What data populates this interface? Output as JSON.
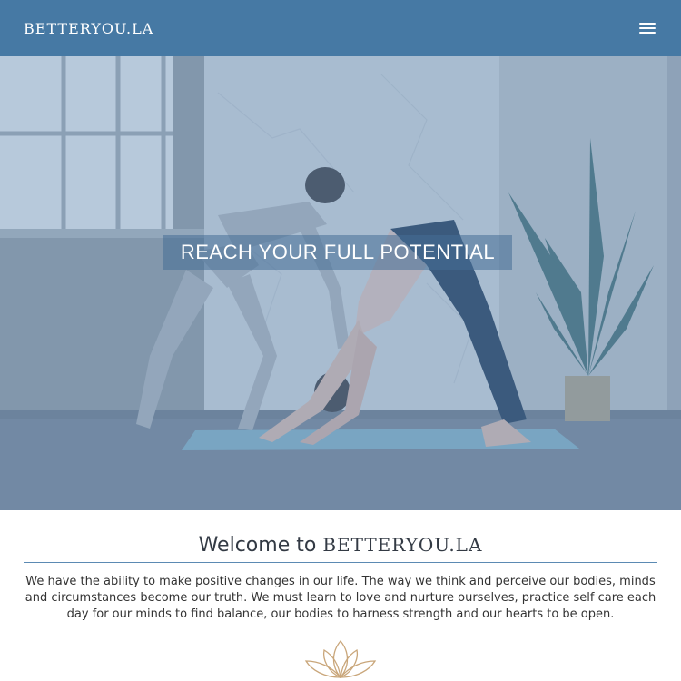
{
  "navbar": {
    "brand": "BETTERYOU.LA",
    "menu_icon": "hamburger-menu-icon"
  },
  "hero": {
    "title": "REACH YOUR FULL POTENTIAL",
    "image": "two women doing yoga, one in downward dog on a mat, instructor adjusting"
  },
  "welcome": {
    "heading_prefix": "Welcome to",
    "heading_brand": "BETTERYOU.LA",
    "body": "We have the ability to make positive changes in our life. The way we think and perceive our bodies, minds and circumstances become our truth. We must learn to love and nurture ourselves, practice self care each day for our minds to find balance, our bodies to harness strength and our hearts to be open.",
    "ornament": "lotus-icon"
  },
  "colors": {
    "navbar": "#4679a4",
    "hero_overlay": "#6f93b8",
    "rule": "#5b8ab3",
    "lotus": "#c9a67a"
  }
}
